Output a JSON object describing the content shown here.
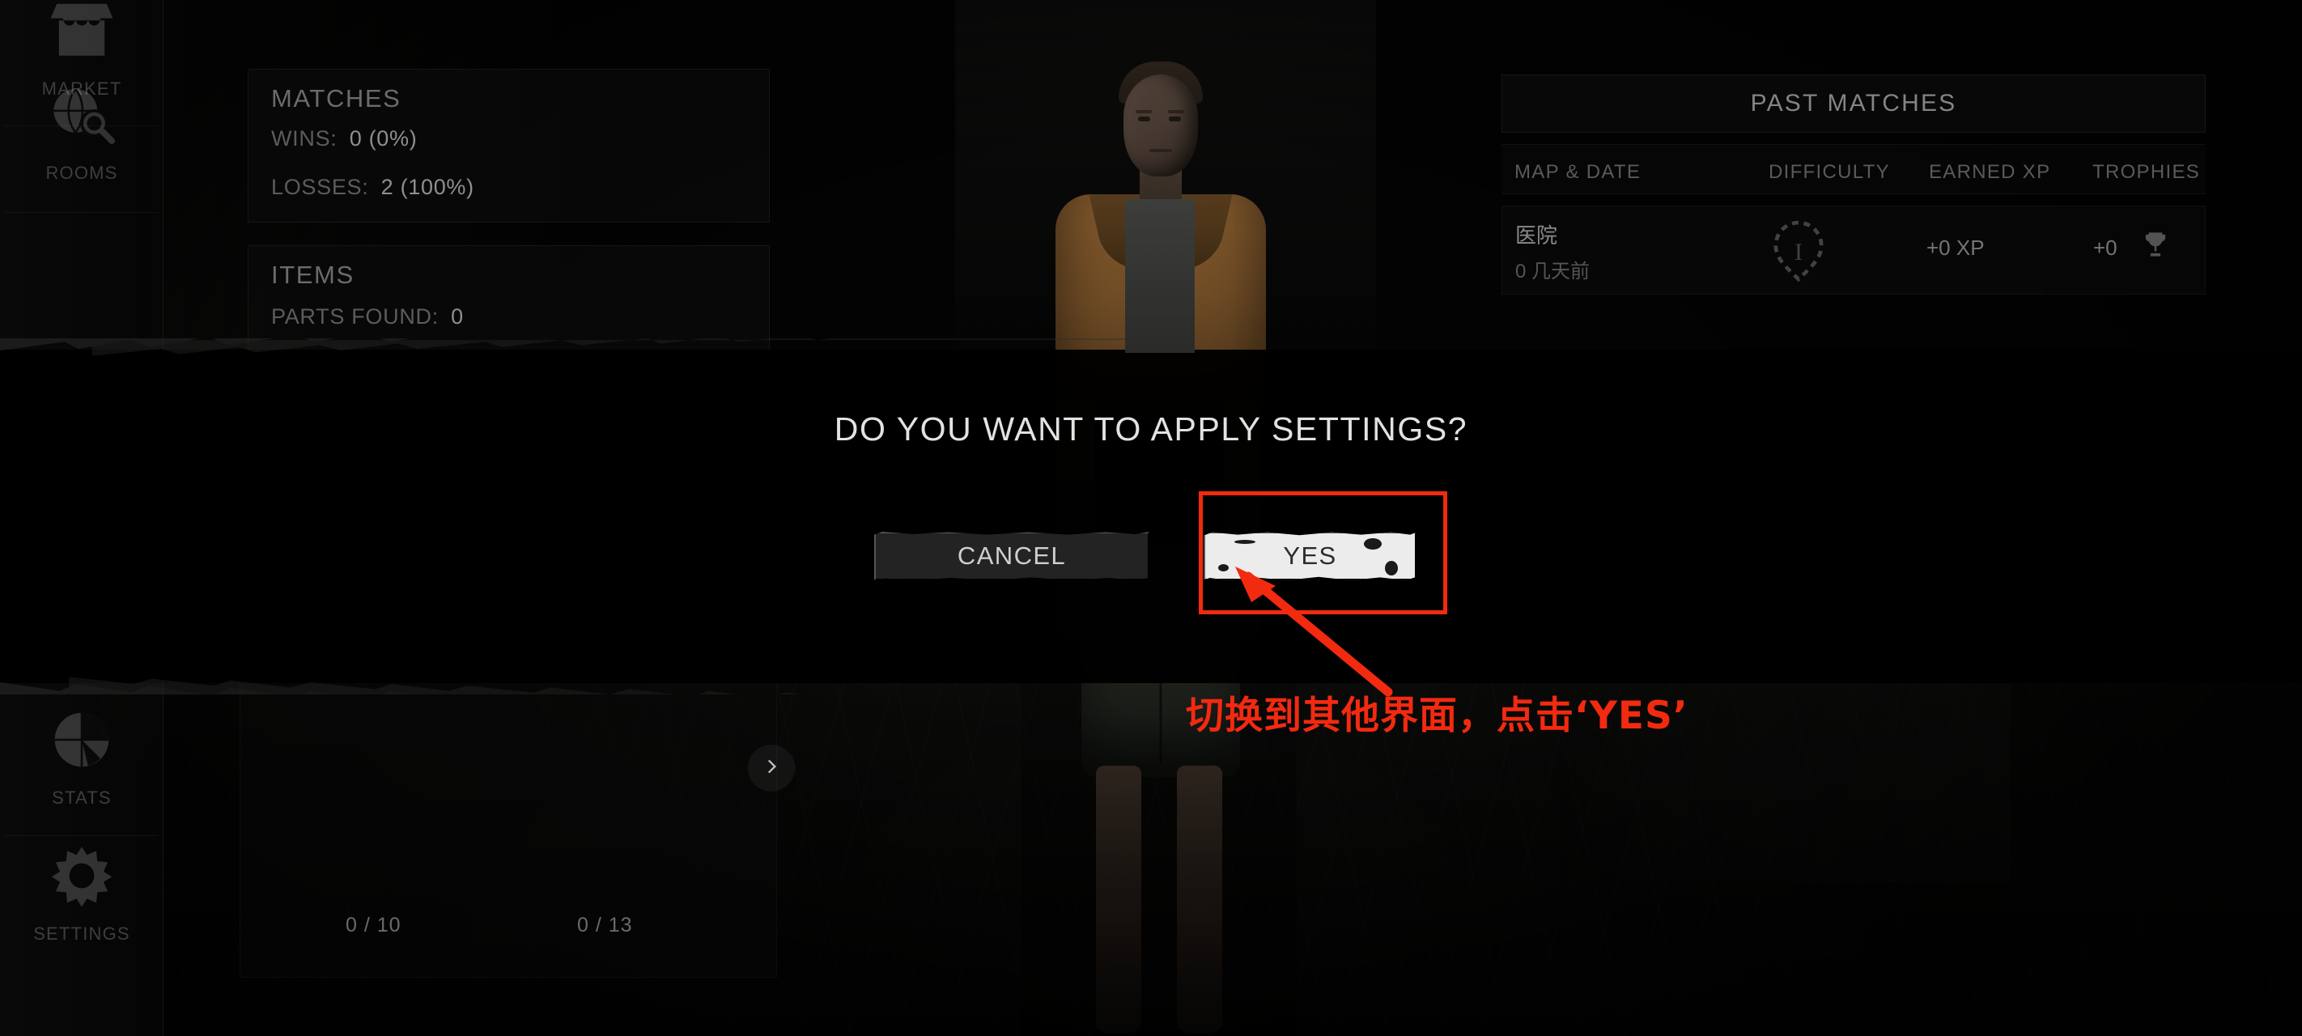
{
  "sidebar": {
    "items": [
      {
        "label": "MARKET",
        "icon": "market-stall-icon"
      },
      {
        "label": "ROOMS",
        "icon": "globe-search-icon"
      },
      {
        "label": "STATS",
        "icon": "pie-chart-icon"
      },
      {
        "label": "SETTINGS",
        "icon": "gear-icon"
      }
    ]
  },
  "stats": {
    "matches": {
      "title": "MATCHES",
      "wins_label": "WINS:",
      "wins_value": "0 (0%)",
      "losses_label": "LOSSES:",
      "losses_value": "2 (100%)"
    },
    "items": {
      "title": "ITEMS",
      "parts_found_label": "PARTS FOUND:",
      "parts_found_value": "0"
    }
  },
  "carousel": {
    "counter_a": "0 / 10",
    "counter_b": "0 / 13",
    "next_icon": "chevron-right-icon"
  },
  "past_matches": {
    "title": "PAST MATCHES",
    "columns": [
      "MAP & DATE",
      "DIFFICULTY",
      "EARNED XP",
      "TROPHIES"
    ],
    "rows": [
      {
        "map": "医院",
        "date": "0 几天前",
        "difficulty": "I",
        "difficulty_icon": "difficulty-shield-icon",
        "earned_xp": "+0 XP",
        "trophies": "+0",
        "trophy_icon": "trophy-icon"
      }
    ]
  },
  "modal": {
    "title": "DO YOU WANT TO APPLY SETTINGS?",
    "cancel_label": "CANCEL",
    "yes_label": "YES"
  },
  "annotation": {
    "text": "切换到其他界面，点击‘YES’",
    "color": "#f22a10",
    "arrow_icon": "arrow-up-left-icon",
    "highlight_target": "yes-button"
  }
}
